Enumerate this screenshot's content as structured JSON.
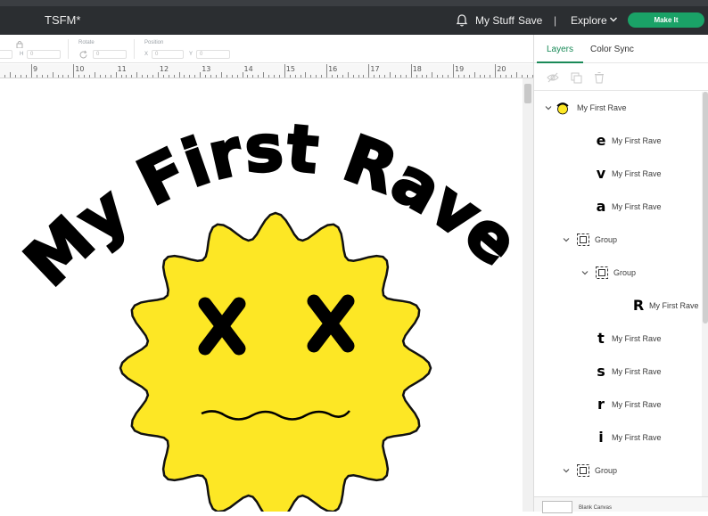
{
  "header": {
    "title": "TSFM*",
    "my_stuff": "My Stuff",
    "save": "Save",
    "separator": "|",
    "explore": "Explore",
    "make_it": "Make It",
    "bell_icon": "bell-icon",
    "accent_color": "#1aa267"
  },
  "toolbar": {
    "size_h_label": "H",
    "size_h_value": "0",
    "rotate_label": "Rotate",
    "rotate_value": "0",
    "position_label": "Position",
    "x_label": "X",
    "x_value": "0",
    "y_label": "Y",
    "y_value": "0"
  },
  "ruler": {
    "numbers": [
      "9",
      "10",
      "11",
      "12",
      "13",
      "14",
      "15",
      "16",
      "17",
      "18",
      "19",
      "20"
    ]
  },
  "design": {
    "headline": "My First Rave",
    "sun_color": "#fde725",
    "ink_color": "#000000"
  },
  "panel": {
    "tabs": [
      {
        "label": "Layers",
        "active": true
      },
      {
        "label": "Color Sync",
        "active": false
      }
    ],
    "layers": [
      {
        "name": "My First Rave",
        "glyph": "",
        "level": 0,
        "expanded": true,
        "kind": "group-thumb"
      },
      {
        "name": "My First Rave",
        "glyph": "e",
        "level": 1,
        "kind": "letter"
      },
      {
        "name": "My First Rave",
        "glyph": "v",
        "level": 1,
        "kind": "letter"
      },
      {
        "name": "My First Rave",
        "glyph": "a",
        "level": 1,
        "kind": "letter"
      },
      {
        "name": "Group",
        "glyph": "",
        "level": 1,
        "expanded": true,
        "kind": "group"
      },
      {
        "name": "Group",
        "glyph": "",
        "level": 2,
        "expanded": true,
        "kind": "group"
      },
      {
        "name": "My First Rave",
        "glyph": "R",
        "level": 3,
        "kind": "letter"
      },
      {
        "name": "My First Rave",
        "glyph": "t",
        "level": 1,
        "kind": "letter"
      },
      {
        "name": "My First Rave",
        "glyph": "s",
        "level": 1,
        "kind": "letter"
      },
      {
        "name": "My First Rave",
        "glyph": "r",
        "level": 1,
        "kind": "letter"
      },
      {
        "name": "My First Rave",
        "glyph": "i",
        "level": 1,
        "kind": "letter"
      },
      {
        "name": "Group",
        "glyph": "",
        "level": 1,
        "expanded": true,
        "kind": "group"
      }
    ],
    "blank_canvas": "Blank Canvas"
  }
}
